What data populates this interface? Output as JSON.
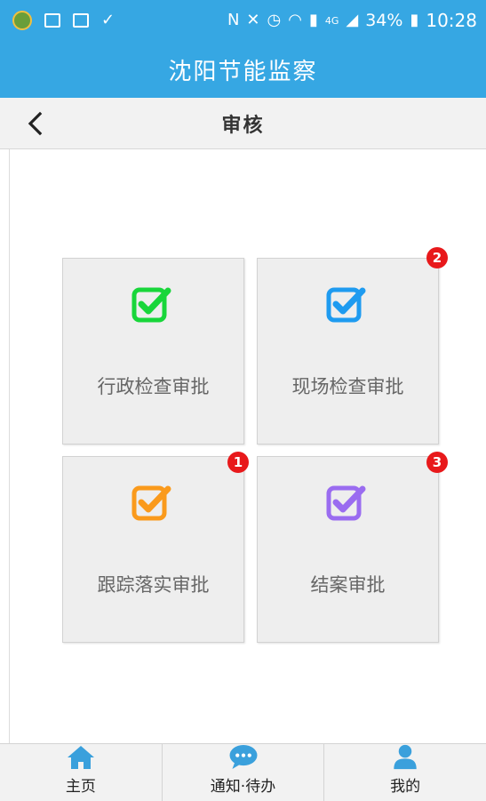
{
  "status_bar": {
    "battery": "34%",
    "time": "10:28",
    "network": "4G"
  },
  "app": {
    "title": "沈阳节能监察"
  },
  "nav": {
    "title": "审核"
  },
  "tiles": [
    {
      "label": "行政检查审批",
      "icon": "checkbox-icon",
      "color": "#18d63a",
      "badge": ""
    },
    {
      "label": "现场检查审批",
      "icon": "checkbox-icon",
      "color": "#1e9bf0",
      "badge": "2"
    },
    {
      "label": "跟踪落实审批",
      "icon": "checkbox-icon",
      "color": "#fa9a1c",
      "badge": "1"
    },
    {
      "label": "结案审批",
      "icon": "checkbox-icon",
      "color": "#9a6cf0",
      "badge": "3"
    }
  ],
  "bottom_nav": [
    {
      "label": "主页",
      "icon": "home-icon"
    },
    {
      "label": "通知·待办",
      "icon": "chat-icon"
    },
    {
      "label": "我的",
      "icon": "user-icon"
    }
  ],
  "colors": {
    "primary": "#36a7e3",
    "badge": "#e8191b",
    "nav_icon": "#3aa0dc"
  }
}
